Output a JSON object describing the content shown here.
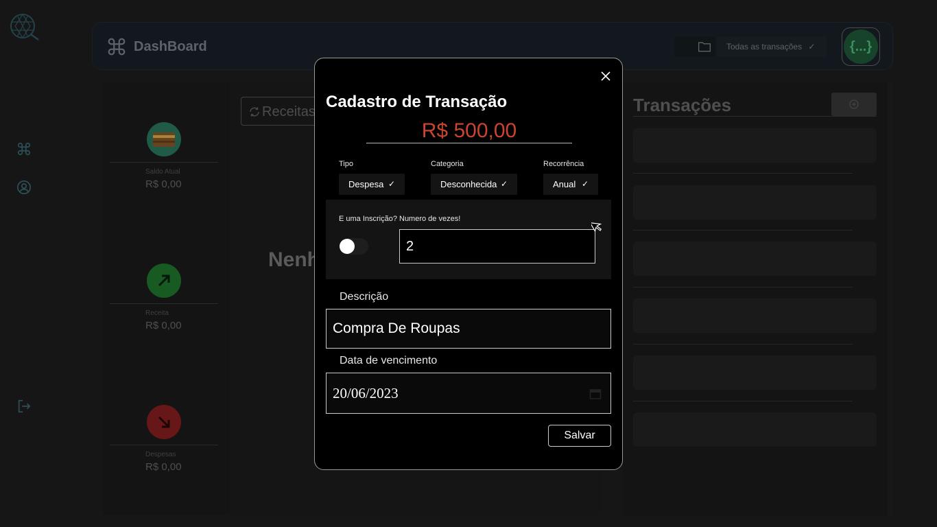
{
  "header": {
    "brand": "DashBoard",
    "filter_label": "Todas as transações",
    "filter_check": "✓",
    "avatar_text": "{...}"
  },
  "cards": [
    {
      "label": "Saldo Atual",
      "value": "R$ 0,00",
      "color": "#2b7a61",
      "icon": "wallet-icon"
    },
    {
      "label": "Receita",
      "value": "R$ 0,00",
      "color": "#1f7a2e",
      "icon": "arrow-up-right-icon"
    },
    {
      "label": "Despesas",
      "value": "R$ 0,00",
      "color": "#8a1f1f",
      "icon": "arrow-down-right-icon"
    }
  ],
  "middle": {
    "search_placeholder": "Receitas",
    "empty_text": "Nenh"
  },
  "transactions": {
    "title": "Transações"
  },
  "modal": {
    "title": "Cadastro de Transação",
    "amount": "R$ 500,00",
    "tipo_label": "Tipo",
    "tipo_value": "Despesa",
    "categoria_label": "Categoria",
    "categoria_value": "Desconhecida",
    "recorrencia_label": "Recorrência",
    "recorrencia_value": "Anual",
    "check": "✓",
    "inscricao_label": "E uma Inscrição?",
    "vezes_label": "Numero de vezes!",
    "vezes_value": "2",
    "descricao_label": "Descrição",
    "descricao_value": "Compra De Roupas",
    "vencimento_label": "Data de vencimento",
    "vencimento_value": "20/06/2023",
    "save_label": "Salvar"
  },
  "colors": {
    "amount": "#c9452f",
    "accent_green": "#4fbf7f"
  }
}
